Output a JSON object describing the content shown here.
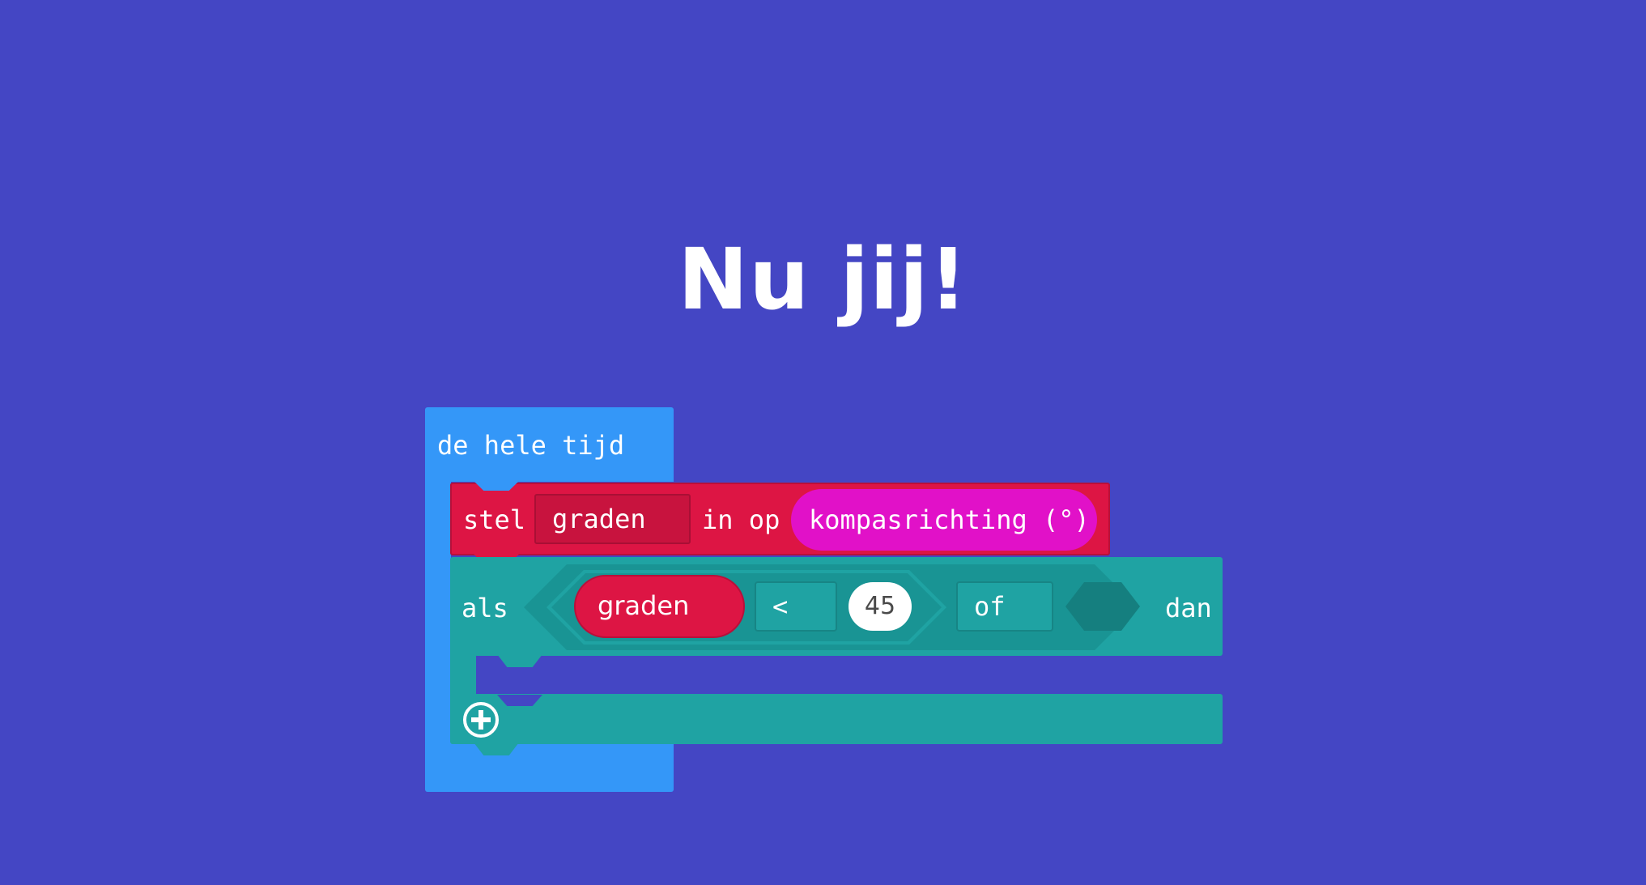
{
  "heading": "Nu jij!",
  "colors": {
    "background": "#4446c4",
    "loop_block": "#3497f8",
    "variable_block": "#dd1544",
    "compass_block": "#e111c8",
    "logic_block": "#1fa3a3"
  },
  "loop": {
    "label": "de hele tijd"
  },
  "set_block": {
    "stel": "stel",
    "variable": "graden",
    "in_op": "in op",
    "reporter": "kompasrichting (°)"
  },
  "if_block": {
    "als": "als",
    "variable": "graden",
    "operator": "<",
    "number": "45",
    "logic_operator": "of",
    "dan": "dan",
    "add_icon": "plus-circle-icon"
  }
}
